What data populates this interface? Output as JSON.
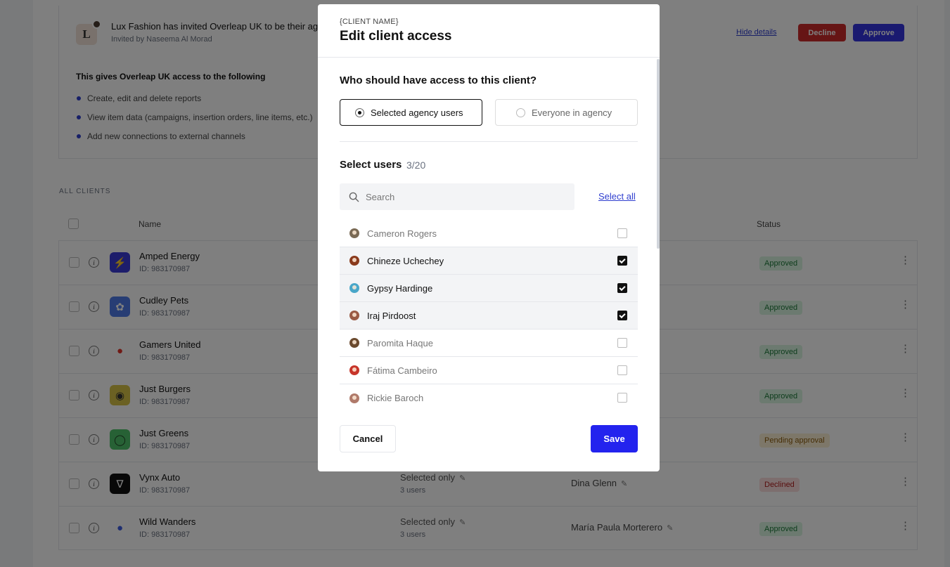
{
  "invite": {
    "logo_letter": "L",
    "title": "Lux Fashion has invited Overleap UK to be their agency",
    "subtitle": "Invited by Naseema Al Morad",
    "hide_details": "Hide details",
    "decline": "Decline",
    "approve": "Approve",
    "access_heading": "This gives Overleap UK access to the following",
    "access_items": [
      "Create, edit and delete reports",
      "View item data (campaigns, insertion orders, line items, etc.)",
      "Add new connections to external channels"
    ]
  },
  "clients": {
    "section_label": "ALL CLIENTS",
    "col_name": "Name",
    "col_status": "Status",
    "rows": [
      {
        "name": "Amped Energy",
        "id": "ID: 983170987",
        "access": "",
        "access_sub": "",
        "manager": "",
        "status": "Approved",
        "logo_color": "#3b3bd6",
        "logo_icon": "bolt-icon"
      },
      {
        "name": "Cudley Pets",
        "id": "ID: 983170987",
        "access": "",
        "access_sub": "",
        "manager": "",
        "status": "Approved",
        "logo_color": "#4f7be8",
        "logo_icon": "paw-icon"
      },
      {
        "name": "Gamers United",
        "id": "ID: 983170987",
        "access": "",
        "access_sub": "",
        "manager": "",
        "status": "Approved",
        "logo_color": "#e0352b",
        "logo_icon": "flame-icon"
      },
      {
        "name": "Just Burgers",
        "id": "ID: 983170987",
        "access": "",
        "access_sub": "",
        "manager": "",
        "status": "Approved",
        "logo_color": "#d6c247",
        "logo_icon": "burger-icon"
      },
      {
        "name": "Just Greens",
        "id": "ID: 983170987",
        "access": "",
        "access_sub": "",
        "manager": "",
        "status": "Pending approval",
        "logo_color": "#4fc26a",
        "logo_icon": "avocado-icon"
      },
      {
        "name": "Vynx Auto",
        "id": "ID: 983170987",
        "access": "Selected only",
        "access_sub": "3 users",
        "manager": "Dina Glenn",
        "status": "Declined",
        "logo_color": "#111111",
        "logo_icon": "v-logo-icon"
      },
      {
        "name": "Wild Wanders",
        "id": "ID: 983170987",
        "access": "Selected only",
        "access_sub": "3 users",
        "manager": "María Paula Morterero",
        "status": "Approved",
        "logo_color": "#3d5ce0",
        "logo_icon": "globe-icon"
      }
    ]
  },
  "modal": {
    "kicker": "{CLIENT NAME}",
    "title": "Edit client access",
    "question": "Who should have access to this client?",
    "options": [
      {
        "label": "Selected agency users",
        "selected": true
      },
      {
        "label": "Everyone in agency",
        "selected": false
      }
    ],
    "select_users_title": "Select users",
    "select_users_count": "3/20",
    "search_placeholder": "Search",
    "select_all": "Select all",
    "users": [
      {
        "name": "Cameron Rogers",
        "checked": false,
        "avatar_color": "#7a6a55"
      },
      {
        "name": "Chineze Uchechey",
        "checked": true,
        "avatar_color": "#8a3a1c"
      },
      {
        "name": "Gypsy Hardinge",
        "checked": true,
        "avatar_color": "#4aa7c9"
      },
      {
        "name": "Iraj Pirdoost",
        "checked": true,
        "avatar_color": "#9a5a44"
      },
      {
        "name": "Paromita Haque",
        "checked": false,
        "avatar_color": "#6b4a2e"
      },
      {
        "name": "Fátima Cambeiro",
        "checked": false,
        "avatar_color": "#c7352a"
      },
      {
        "name": "Rickie Baroch",
        "checked": false,
        "avatar_color": "#b07a6a"
      }
    ],
    "cancel": "Cancel",
    "save": "Save"
  }
}
